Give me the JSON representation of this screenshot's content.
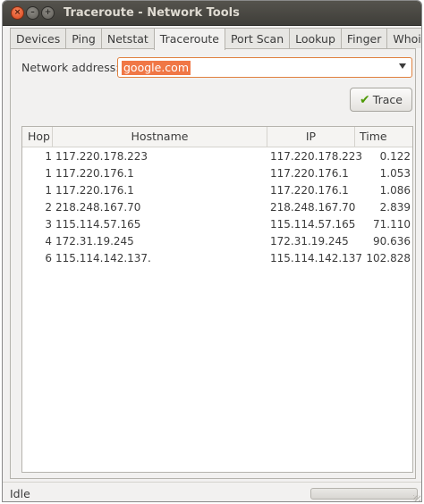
{
  "window": {
    "title": "Traceroute - Network Tools",
    "buttons": {
      "close": "×",
      "minimize": "–",
      "maximize": "+"
    }
  },
  "tabs": [
    {
      "label": "Devices"
    },
    {
      "label": "Ping"
    },
    {
      "label": "Netstat"
    },
    {
      "label": "Traceroute",
      "active": true
    },
    {
      "label": "Port Scan"
    },
    {
      "label": "Lookup"
    },
    {
      "label": "Finger"
    },
    {
      "label": "Whois"
    }
  ],
  "form": {
    "address_label": "Network address:",
    "address_value": "google.com",
    "trace_label": "Trace",
    "trace_icon": "check-icon"
  },
  "table": {
    "headers": {
      "hop": "Hop",
      "hostname": "Hostname",
      "ip": "IP",
      "time": "Time"
    },
    "rows": [
      {
        "hop": "1",
        "hostname": "117.220.178.223",
        "ip": "117.220.178.223",
        "time": "0.122"
      },
      {
        "hop": "1",
        "hostname": "117.220.176.1",
        "ip": "117.220.176.1",
        "time": "1.053"
      },
      {
        "hop": "1",
        "hostname": "117.220.176.1",
        "ip": "117.220.176.1",
        "time": "1.086"
      },
      {
        "hop": "2",
        "hostname": "218.248.167.70",
        "ip": "218.248.167.70",
        "time": "2.839"
      },
      {
        "hop": "3",
        "hostname": "115.114.57.165",
        "ip": "115.114.57.165",
        "time": "71.110"
      },
      {
        "hop": "4",
        "hostname": "172.31.19.245",
        "ip": "172.31.19.245",
        "time": "90.636"
      },
      {
        "hop": "6",
        "hostname": "115.114.142.137.",
        "ip": "115.114.142.137",
        "time": "102.828"
      }
    ]
  },
  "status": {
    "text": "Idle"
  },
  "colors": {
    "accent": "#f07746",
    "titlebar": "#3f3e39",
    "trace_icon": "#4e9a06"
  }
}
